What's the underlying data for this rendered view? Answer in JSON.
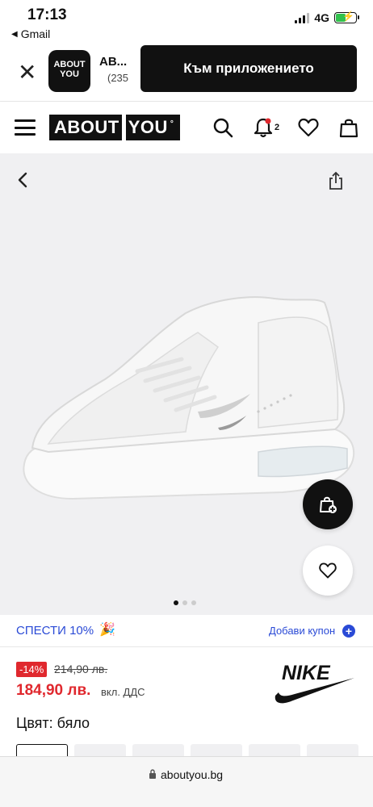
{
  "status": {
    "time": "17:13",
    "back_app": "Gmail",
    "network": "4G"
  },
  "banner": {
    "app_logo_text": "ABOUT YOU",
    "app_name": "AB...",
    "reviews": "(235",
    "open_app_label": "Към приложението"
  },
  "nav": {
    "logo": "ABOUT YOU",
    "notification_count": "2"
  },
  "gallery": {
    "image_count": 3,
    "active_image": 1
  },
  "promo": {
    "save_label": "СПЕСТИ 10%",
    "coupon_label": "Добави купон"
  },
  "price": {
    "discount": "-14%",
    "old_price": "214,90 лв.",
    "new_price": "184,90 лв.",
    "vat_note": "вкл. ДДС"
  },
  "brand": "NIKE",
  "color_label": "Цвят: бяло",
  "url": "aboutyou.bg",
  "colors": {
    "accent_blue": "#2a4ad6",
    "sale_red": "#e0282e",
    "ink": "#111111",
    "gallery_bg": "#f0f0f2"
  }
}
